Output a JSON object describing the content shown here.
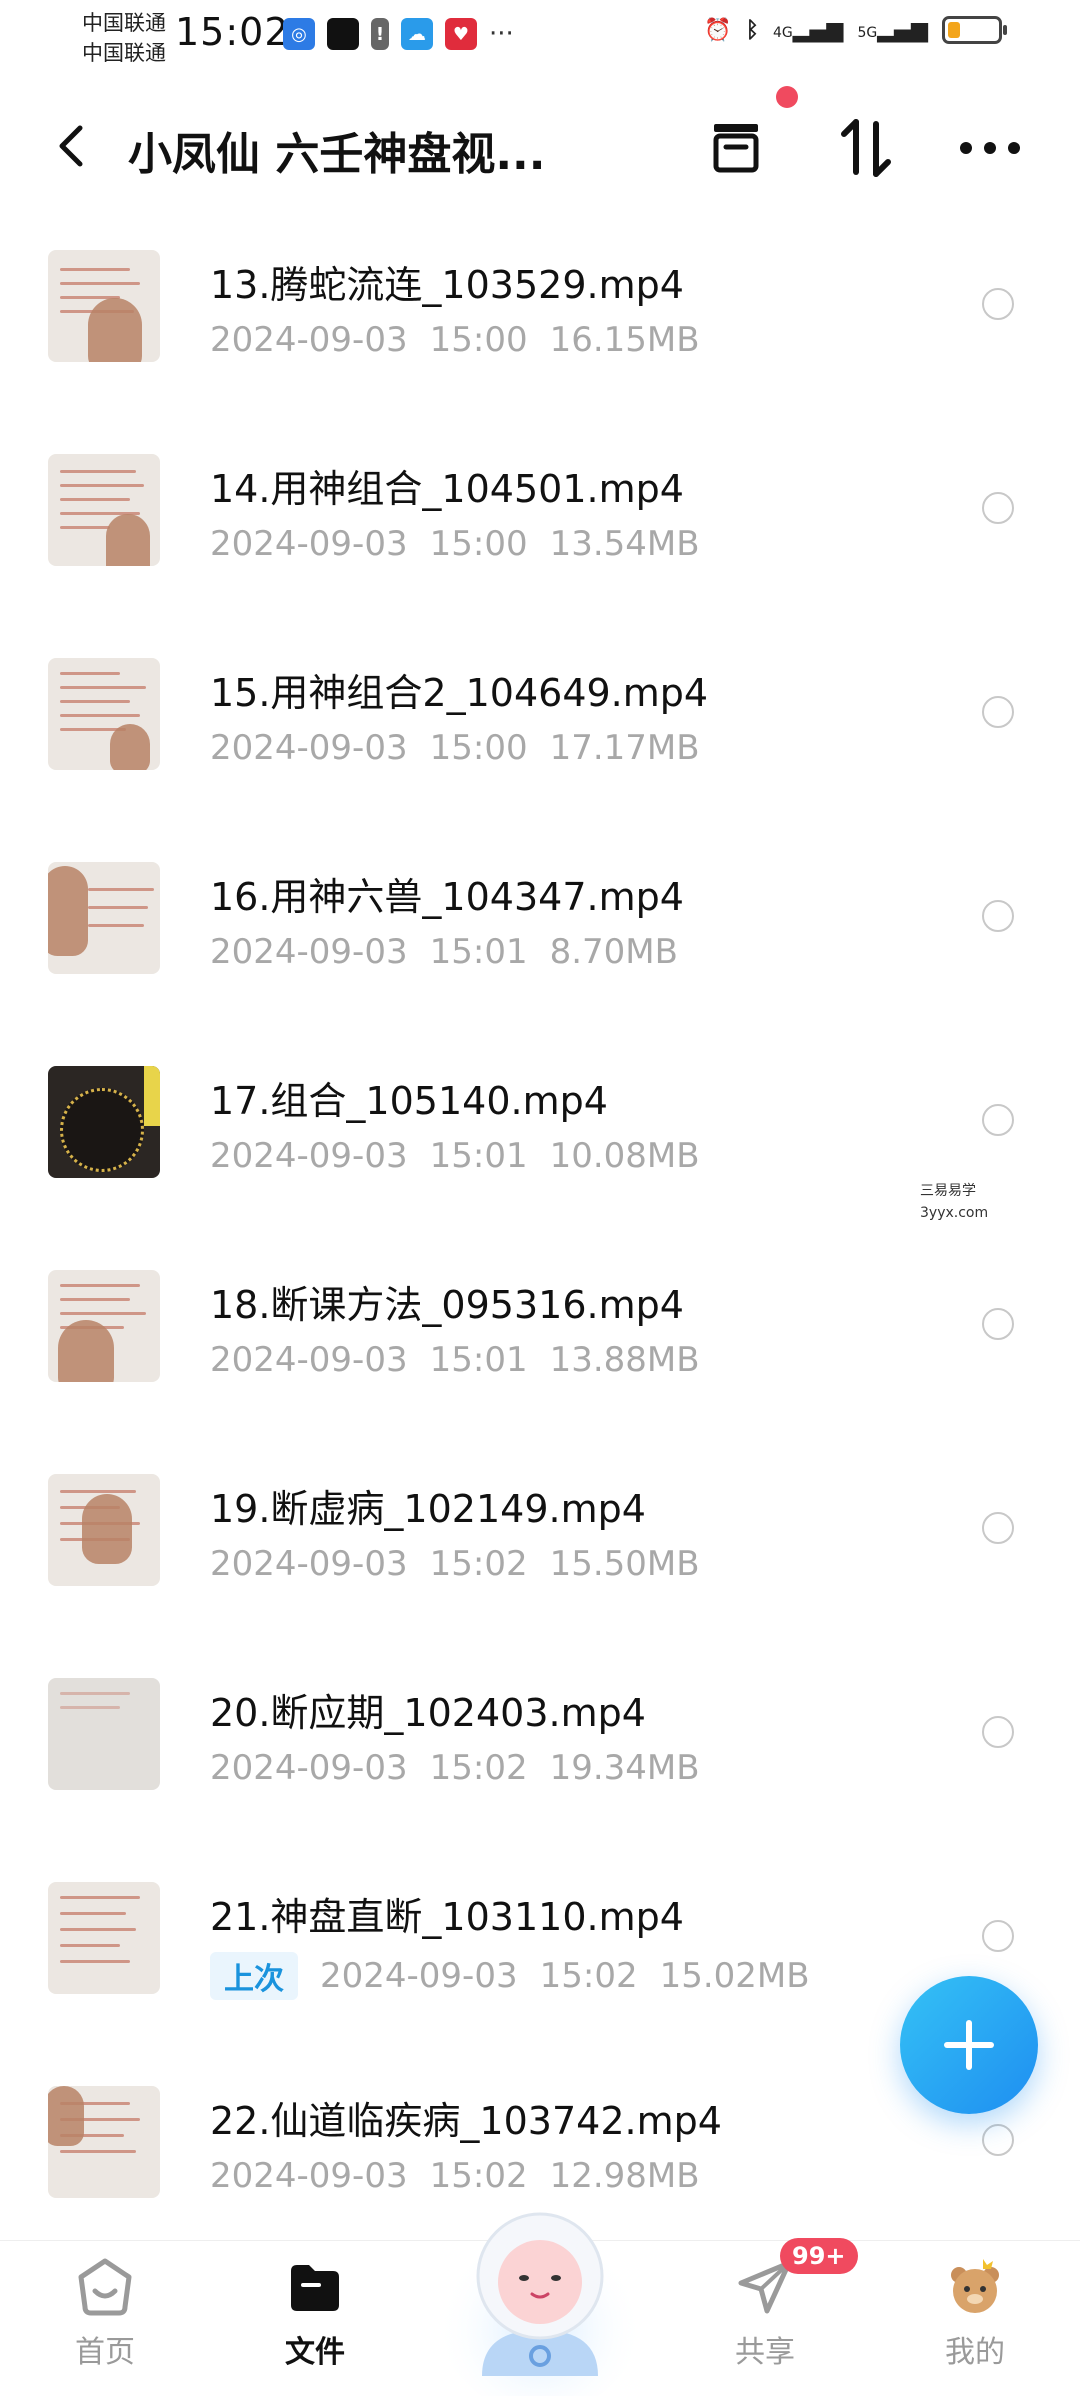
{
  "status_bar": {
    "carrier_1": "中国联通",
    "carrier_2": "中国联通",
    "time": "15:02",
    "more": "···",
    "net_1": "4G",
    "net_2": "5G"
  },
  "header": {
    "title": "小凤仙 六壬神盘视...",
    "back_icon": "chevron-left-icon",
    "archive_icon": "archive-box-icon",
    "sort_icon": "sort-arrows-icon",
    "more_icon": "more-horizontal-icon"
  },
  "files": [
    {
      "name": "13.腾蛇流连_103529.mp4",
      "date": "2024-09-03",
      "time": "15:00",
      "size": "16.15MB",
      "tag": ""
    },
    {
      "name": "14.用神组合_104501.mp4",
      "date": "2024-09-03",
      "time": "15:00",
      "size": "13.54MB",
      "tag": ""
    },
    {
      "name": "15.用神组合2_104649.mp4",
      "date": "2024-09-03",
      "time": "15:00",
      "size": "17.17MB",
      "tag": ""
    },
    {
      "name": "16.用神六兽_104347.mp4",
      "date": "2024-09-03",
      "time": "15:01",
      "size": "8.70MB",
      "tag": ""
    },
    {
      "name": "17.组合_105140.mp4",
      "date": "2024-09-03",
      "time": "15:01",
      "size": "10.08MB",
      "tag": ""
    },
    {
      "name": "18.断课方法_095316.mp4",
      "date": "2024-09-03",
      "time": "15:01",
      "size": "13.88MB",
      "tag": ""
    },
    {
      "name": "19.断虚病_102149.mp4",
      "date": "2024-09-03",
      "time": "15:02",
      "size": "15.50MB",
      "tag": ""
    },
    {
      "name": "20.断应期_102403.mp4",
      "date": "2024-09-03",
      "time": "15:02",
      "size": "19.34MB",
      "tag": ""
    },
    {
      "name": "21.神盘直断_103110.mp4",
      "date": "2024-09-03",
      "time": "15:02",
      "size": "15.02MB",
      "tag": "上次"
    },
    {
      "name": "22.仙道临疾病_103742.mp4",
      "date": "2024-09-03",
      "time": "15:02",
      "size": "12.98MB",
      "tag": ""
    }
  ],
  "watermark": {
    "line1": "三易易学",
    "line2": "3yyx.com"
  },
  "fab": {
    "icon": "plus-icon"
  },
  "bottom_nav": {
    "home": "首页",
    "files": "文件",
    "share": "共享",
    "mine": "我的",
    "share_badge": "99+"
  },
  "colors": {
    "accent": "#1E8EF1",
    "badge": "#F04A5F",
    "meta_text": "#A8A8A8",
    "tag_bg": "#EAF5FD",
    "tag_text": "#1A93DD"
  }
}
